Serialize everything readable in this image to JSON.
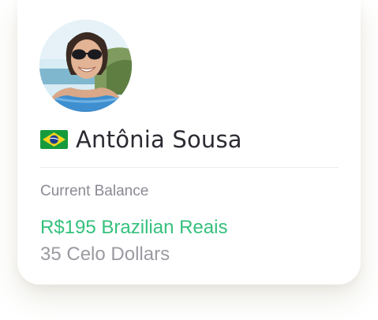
{
  "profile": {
    "name": "Antônia Sousa",
    "country_flag": "brazil-flag-icon",
    "avatar": "user-avatar-photo"
  },
  "balance": {
    "label": "Current Balance",
    "primary": "R$195 Brazilian Reais",
    "secondary": "35 Celo Dollars"
  },
  "colors": {
    "primary_balance": "#35c07c",
    "secondary_balance": "#9a9aa2",
    "label": "#8a8a93",
    "name": "#2b2b33"
  }
}
